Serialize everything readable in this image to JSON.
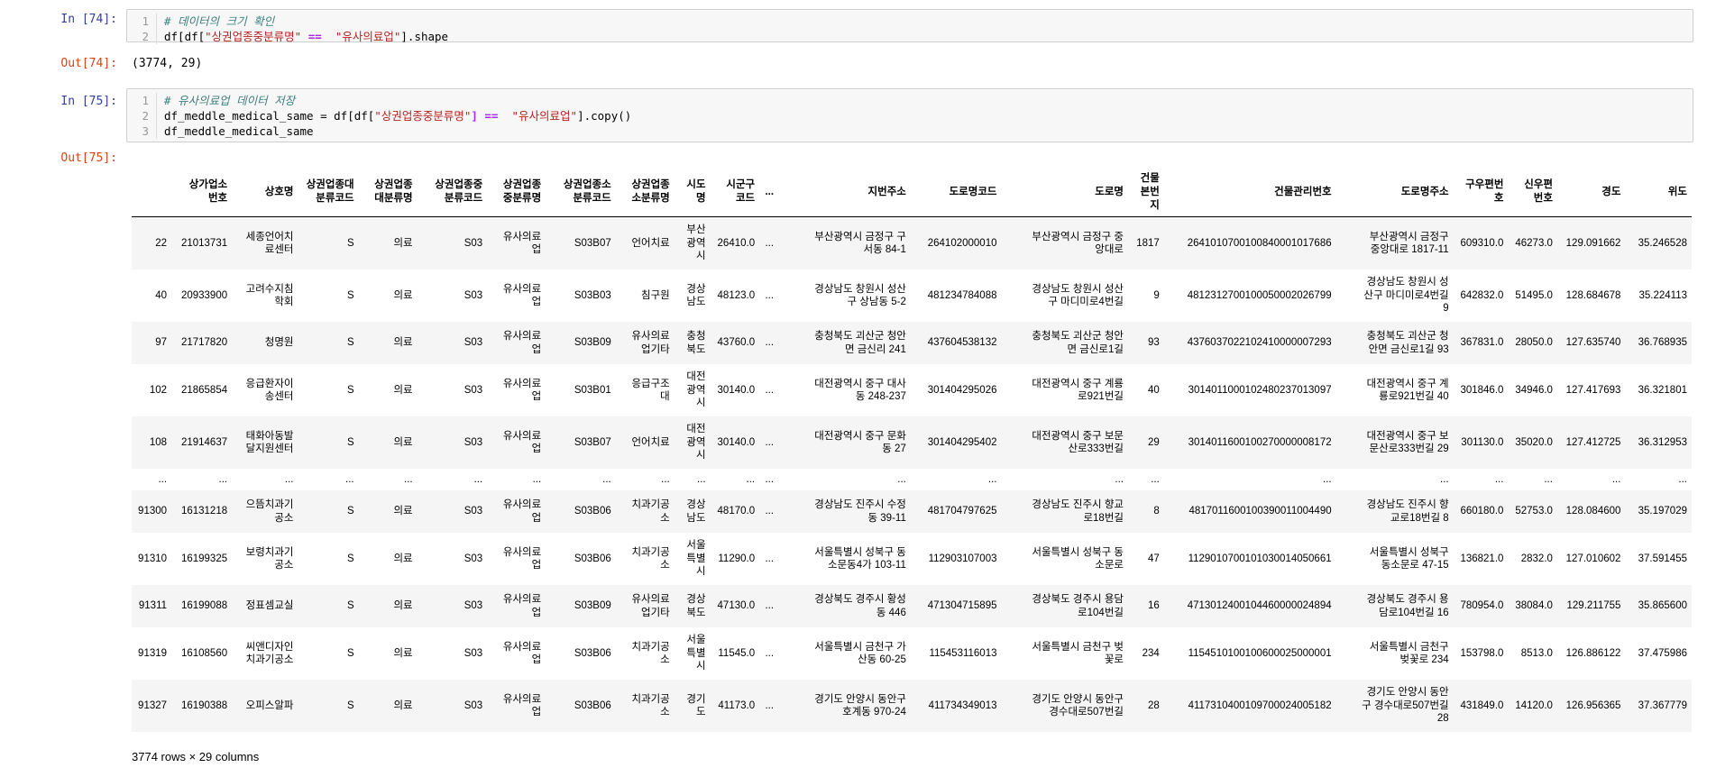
{
  "cells": [
    {
      "in_prompt": "In [74]:",
      "code": [
        {
          "n": "1",
          "comment": "# 데이터의 크기 확인"
        },
        {
          "n": "2",
          "a": "df[df[",
          "s1": "\"상권업종중분류명\"",
          "op": " == ",
          "s2": " \"유사의료업\"",
          "b": "].shape"
        }
      ],
      "out_prompt": "Out[74]:",
      "output": "(3774, 29)"
    },
    {
      "in_prompt": "In [75]:",
      "code": [
        {
          "n": "1",
          "comment": "# 유사의료업 데이터 저장"
        },
        {
          "n": "2",
          "a": "df_meddle_medical_same = df[df[",
          "s1": "\"상권업종중분류명\"",
          "op": "] == ",
          "s2": " \"유사의료업\"",
          "b": "].copy()"
        },
        {
          "n": "3",
          "a": "df_meddle_medical_same"
        }
      ],
      "out_prompt": "Out[75]:"
    }
  ],
  "table": {
    "columns": [
      "",
      "상가업소\n번호",
      "상호명",
      "상권업종대\n분류코드",
      "상권업종\n대분류명",
      "상권업종중\n분류코드",
      "상권업종\n중분류명",
      "상권업종소\n분류코드",
      "상권업종\n소분류명",
      "시도\n명",
      "시군구\n코드",
      "...",
      "지번주소",
      "도로명코드",
      "도로명",
      "건물\n본번\n지",
      "건물관리번호",
      "도로명주소",
      "구우편번\n호",
      "신우편\n번호",
      "경도",
      "위도"
    ],
    "rows": [
      [
        "22",
        "21013731",
        "세종언어치\n료센터",
        "S",
        "의료",
        "S03",
        "유사의료\n업",
        "S03B07",
        "언어치료",
        "부산\n광역\n시",
        "26410.0",
        "...",
        "부산광역시 금정구 구\n서동 84-1",
        "264102000010",
        "부산광역시 금정구 중\n앙대로",
        "1817",
        "2641010700100840001017686",
        "부산광역시 금정구\n중앙대로 1817-11",
        "609310.0",
        "46273.0",
        "129.091662",
        "35.246528"
      ],
      [
        "40",
        "20933900",
        "고려수지침\n학회",
        "S",
        "의료",
        "S03",
        "유사의료\n업",
        "S03B03",
        "침구원",
        "경상\n남도",
        "48123.0",
        "...",
        "경상남도 창원시 성산\n구 상남동 5-2",
        "481234784088",
        "경상남도 창원시 성산\n구 마디미로4번길",
        "9",
        "4812312700100050002026799",
        "경상남도 창원시 성\n산구 마디미로4번길\n9",
        "642832.0",
        "51495.0",
        "128.684678",
        "35.224113"
      ],
      [
        "97",
        "21717820",
        "청명원",
        "S",
        "의료",
        "S03",
        "유사의료\n업",
        "S03B09",
        "유사의료\n업기타",
        "충청\n북도",
        "43760.0",
        "...",
        "충청북도 괴산군 청안\n면 금신리 241",
        "437604538132",
        "충청북도 괴산군 청안\n면 금신로1길",
        "93",
        "4376037022102410000007293",
        "충청북도 괴산군 청\n안면 금신로1길 93",
        "367831.0",
        "28050.0",
        "127.635740",
        "36.768935"
      ],
      [
        "102",
        "21865854",
        "응급환자이\n송센터",
        "S",
        "의료",
        "S03",
        "유사의료\n업",
        "S03B01",
        "응급구조\n대",
        "대전\n광역\n시",
        "30140.0",
        "...",
        "대전광역시 중구 대사\n동 248-237",
        "301404295026",
        "대전광역시 중구 계룡\n로921번길",
        "40",
        "3014011000102480237013097",
        "대전광역시 중구 계\n룡로921번길 40",
        "301846.0",
        "34946.0",
        "127.417693",
        "36.321801"
      ],
      [
        "108",
        "21914637",
        "태화아동발\n달지원센터",
        "S",
        "의료",
        "S03",
        "유사의료\n업",
        "S03B07",
        "언어치료",
        "대전\n광역\n시",
        "30140.0",
        "...",
        "대전광역시 중구 문화\n동 27",
        "301404295402",
        "대전광역시 중구 보문\n산로333번길",
        "29",
        "3014011600100270000008172",
        "대전광역시 중구 보\n문산로333번길 29",
        "301130.0",
        "35020.0",
        "127.412725",
        "36.312953"
      ],
      [
        "...",
        "...",
        "...",
        "...",
        "...",
        "...",
        "...",
        "...",
        "...",
        "...",
        "...",
        "...",
        "...",
        "...",
        "...",
        "...",
        "...",
        "...",
        "...",
        "...",
        "...",
        "..."
      ],
      [
        "91300",
        "16131218",
        "으뜸치과기\n공소",
        "S",
        "의료",
        "S03",
        "유사의료\n업",
        "S03B06",
        "치과기공\n소",
        "경상\n남도",
        "48170.0",
        "...",
        "경상남도 진주시 수정\n동 39-11",
        "481704797625",
        "경상남도 진주시 향교\n로18번길",
        "8",
        "4817011600100390011004490",
        "경상남도 진주시 향\n교로18번길 8",
        "660180.0",
        "52753.0",
        "128.084600",
        "35.197029"
      ],
      [
        "91310",
        "16199325",
        "보령치과기\n공소",
        "S",
        "의료",
        "S03",
        "유사의료\n업",
        "S03B06",
        "치과기공\n소",
        "서울\n특별\n시",
        "11290.0",
        "...",
        "서울특별시 성북구 동\n소문동4가 103-11",
        "112903107003",
        "서울특별시 성북구 동\n소문로",
        "47",
        "1129010700101030014050661",
        "서울특별시 성북구\n동소문로 47-15",
        "136821.0",
        "2832.0",
        "127.010602",
        "37.591455"
      ],
      [
        "91311",
        "16199088",
        "정표셈교실",
        "S",
        "의료",
        "S03",
        "유사의료\n업",
        "S03B09",
        "유사의료\n업기타",
        "경상\n북도",
        "47130.0",
        "...",
        "경상북도 경주시 황성\n동 446",
        "471304715895",
        "경상북도 경주시 용담\n로104번길",
        "16",
        "4713012400104460000024894",
        "경상북도 경주시 용\n담로104번길 16",
        "780954.0",
        "38084.0",
        "129.211755",
        "35.865600"
      ],
      [
        "91319",
        "16108560",
        "씨앤디자인\n치과기공소",
        "S",
        "의료",
        "S03",
        "유사의료\n업",
        "S03B06",
        "치과기공\n소",
        "서울\n특별\n시",
        "11545.0",
        "...",
        "서울특별시 금천구 가\n산동 60-25",
        "115453116013",
        "서울특별시 금천구 벚\n꽃로",
        "234",
        "1154510100100600025000001",
        "서울특별시 금천구\n벚꽃로 234",
        "153798.0",
        "8513.0",
        "126.886122",
        "37.475986"
      ],
      [
        "91327",
        "16190388",
        "오피스알파",
        "S",
        "의료",
        "S03",
        "유사의료\n업",
        "S03B06",
        "치과기공\n소",
        "경기\n도",
        "41173.0",
        "...",
        "경기도 안양시 동안구\n호계동 970-24",
        "411734349013",
        "경기도 안양시 동안구\n경수대로507번길",
        "28",
        "4117310400109700024005182",
        "경기도 안양시 동안\n구 경수대로507번길\n28",
        "431849.0",
        "14120.0",
        "126.956365",
        "37.367779"
      ]
    ],
    "shape_text": "3774 rows × 29 columns"
  }
}
